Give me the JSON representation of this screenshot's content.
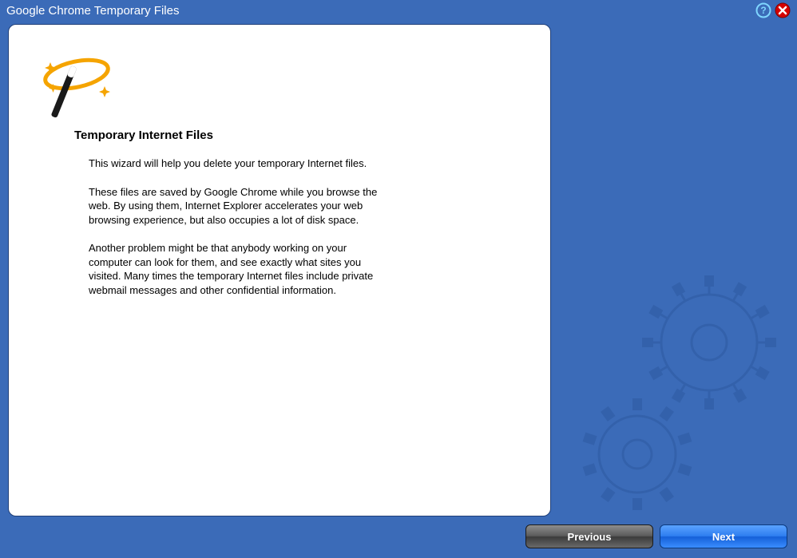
{
  "window": {
    "title": "Google Chrome Temporary Files"
  },
  "content": {
    "heading": "Temporary Internet Files",
    "p1": "This wizard will help you delete your temporary Internet files.",
    "p2": "These files are saved by Google Chrome while you browse the web. By using them, Internet Explorer accelerates your web browsing experience, but also occupies a lot of disk space.",
    "p3": "Another problem might be that anybody working on your computer can look for them, and see exactly what sites you visited. Many times the temporary Internet files include private webmail messages and other confidential information."
  },
  "buttons": {
    "previous": "Previous",
    "next": "Next"
  }
}
